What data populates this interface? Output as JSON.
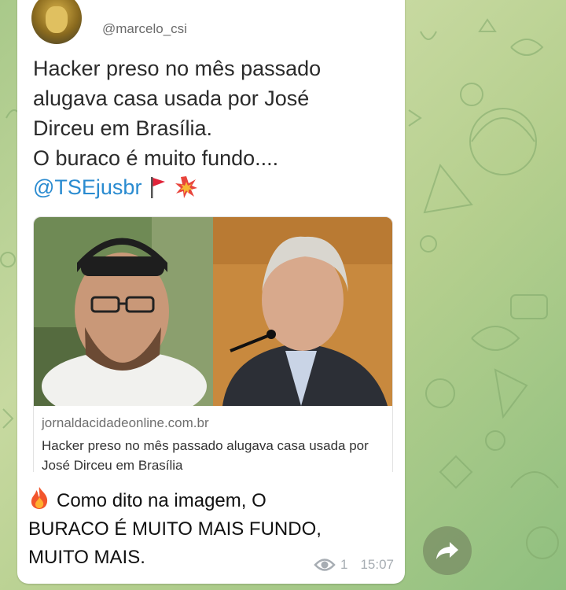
{
  "tweet": {
    "handle": "@marcelo_csi",
    "lines": [
      "Hacker preso no mês passado",
      "alugava casa usada por José",
      "Dirceu em Brasília.",
      "O buraco é muito fundo...."
    ],
    "mention": "@TSEjusbr"
  },
  "link_preview": {
    "domain": "jornaldacidadeonline.com.br",
    "headline": "Hacker preso no mês passado alugava casa usada por José Dirceu em Brasília"
  },
  "message": {
    "caption_prefix_icon": "fire-icon",
    "caption_lines": [
      "Como dito na imagem, O",
      "BURACO É MUITO MAIS FUNDO,",
      "MUITO MAIS."
    ],
    "views": "1",
    "time": "15:07"
  },
  "icons": {
    "flag": "red-flag-icon",
    "burst": "collision-icon",
    "views": "eye-icon",
    "share": "share-arrow-icon"
  },
  "colors": {
    "mention": "#2a8bd0",
    "meta": "#a7adb3",
    "bubble": "#ffffff"
  }
}
